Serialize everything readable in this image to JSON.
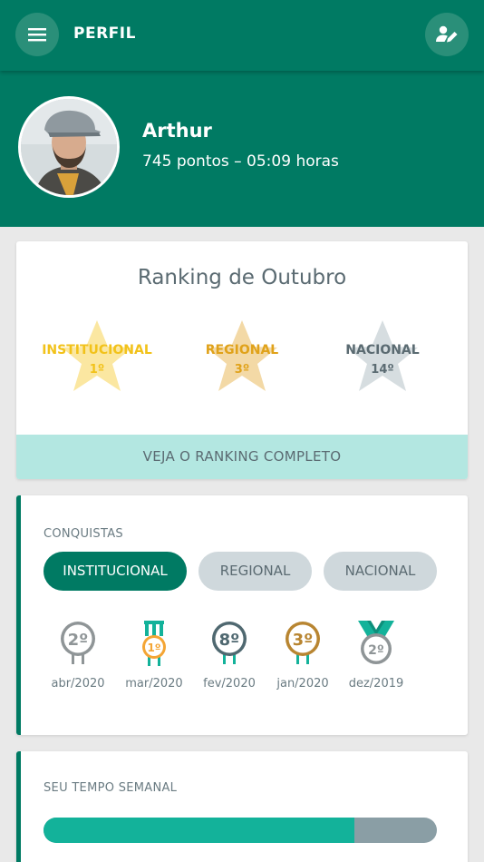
{
  "header": {
    "title": "PERFIL",
    "menu_icon": "hamburger-menu-icon",
    "edit_icon": "edit-profile-icon"
  },
  "profile": {
    "name": "Arthur",
    "stats": "745 pontos – 05:09 horas"
  },
  "ranking": {
    "title": "Ranking de Outubro",
    "items": [
      {
        "label": "INSTITUCIONAL",
        "position": "1º",
        "color": "#f2c21a",
        "star_color": "#fbe7a1"
      },
      {
        "label": "REGIONAL",
        "position": "3º",
        "color": "#e0a21a",
        "star_color": "#f3d9a6"
      },
      {
        "label": "NACIONAL",
        "position": "14º",
        "color": "#5b6b72",
        "star_color": "#d6dde0"
      }
    ],
    "button": "VEJA O RANKING COMPLETO"
  },
  "achievements": {
    "label": "CONQUISTAS",
    "tabs": [
      "INSTITUCIONAL",
      "REGIONAL",
      "NACIONAL"
    ],
    "active_tab": "INSTITUCIONAL",
    "medals": [
      {
        "number": "2º",
        "date": "abr/2020",
        "type": "badge",
        "color": "#8f9597"
      },
      {
        "number": "1º",
        "date": "mar/2020",
        "type": "ribbon-medal",
        "color": "#f4a534"
      },
      {
        "number": "8º",
        "date": "fev/2020",
        "type": "badge",
        "color": "#4f6870"
      },
      {
        "number": "3º",
        "date": "jan/2020",
        "type": "badge",
        "color": "#b88531"
      },
      {
        "number": "2º",
        "date": "dez/2019",
        "type": "wide-ribbon-medal",
        "color": "#8f9597"
      }
    ]
  },
  "weekly_time": {
    "label": "SEU TEMPO SEMANAL",
    "progress_fraction": 0.79
  },
  "colors": {
    "primary": "#007a63",
    "accent": "#13b29a",
    "light_teal": "#b3e7e1"
  }
}
